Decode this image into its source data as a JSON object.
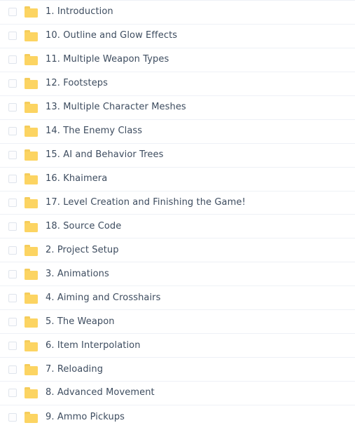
{
  "list": {
    "icon_name": "folder-icon",
    "checkbox_name": "row-checkbox",
    "colors": {
      "folder_fill": "#fcd462",
      "folder_tab": "#f5cd5c",
      "text": "#3d4c5f",
      "row_separator": "#eef1f6",
      "checkbox_border": "#dfe4ec",
      "background": "#ffffff"
    },
    "items": [
      {
        "label": "1. Introduction",
        "checked": false
      },
      {
        "label": "10. Outline and Glow Effects",
        "checked": false
      },
      {
        "label": "11. Multiple Weapon Types",
        "checked": false
      },
      {
        "label": "12. Footsteps",
        "checked": false
      },
      {
        "label": "13. Multiple Character Meshes",
        "checked": false
      },
      {
        "label": "14. The Enemy Class",
        "checked": false
      },
      {
        "label": "15. AI and Behavior Trees",
        "checked": false
      },
      {
        "label": "16. Khaimera",
        "checked": false
      },
      {
        "label": "17. Level Creation and Finishing the Game!",
        "checked": false
      },
      {
        "label": "18. Source Code",
        "checked": false
      },
      {
        "label": "2. Project Setup",
        "checked": false
      },
      {
        "label": "3. Animations",
        "checked": false
      },
      {
        "label": "4. Aiming and Crosshairs",
        "checked": false
      },
      {
        "label": "5. The Weapon",
        "checked": false
      },
      {
        "label": "6. Item Interpolation",
        "checked": false
      },
      {
        "label": "7. Reloading",
        "checked": false
      },
      {
        "label": "8. Advanced Movement",
        "checked": false
      },
      {
        "label": "9. Ammo Pickups",
        "checked": false
      }
    ]
  }
}
